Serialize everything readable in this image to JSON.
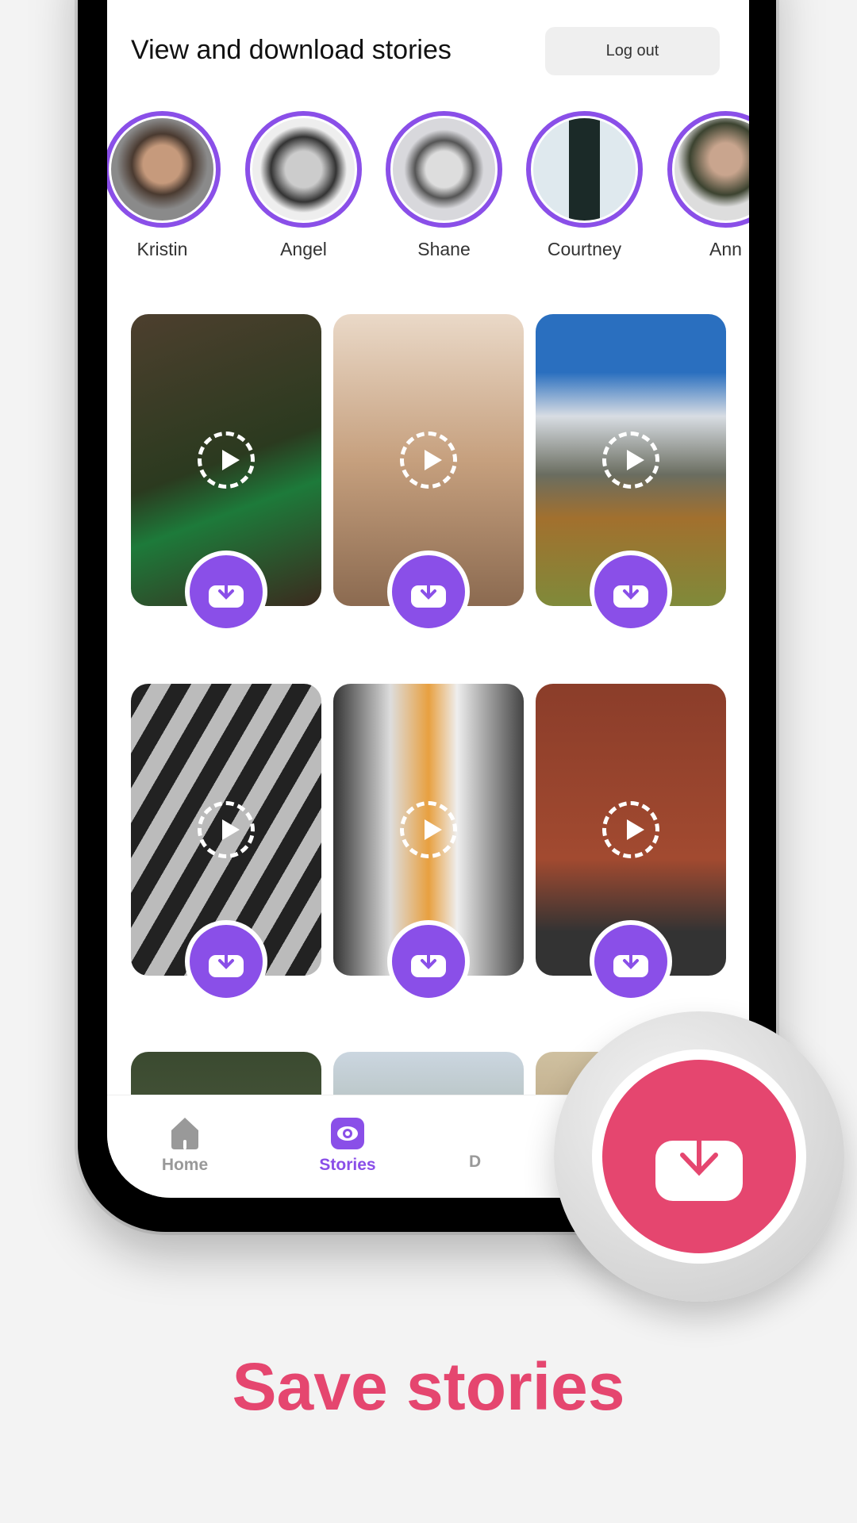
{
  "header": {
    "title": "View and download stories",
    "logout_label": "Log out"
  },
  "stories": [
    {
      "name": "Kristin"
    },
    {
      "name": "Angel"
    },
    {
      "name": "Shane"
    },
    {
      "name": "Courtney"
    },
    {
      "name": "Ann"
    }
  ],
  "grid_count": 9,
  "nav": {
    "items": [
      {
        "label": "Home",
        "icon": "home-icon"
      },
      {
        "label": "Stories",
        "icon": "eye-icon",
        "active": true
      },
      {
        "label": "D",
        "icon": "download-icon"
      }
    ]
  },
  "colors": {
    "accent": "#8a4fe8",
    "pink": "#e5466f"
  },
  "caption": "Save stories"
}
